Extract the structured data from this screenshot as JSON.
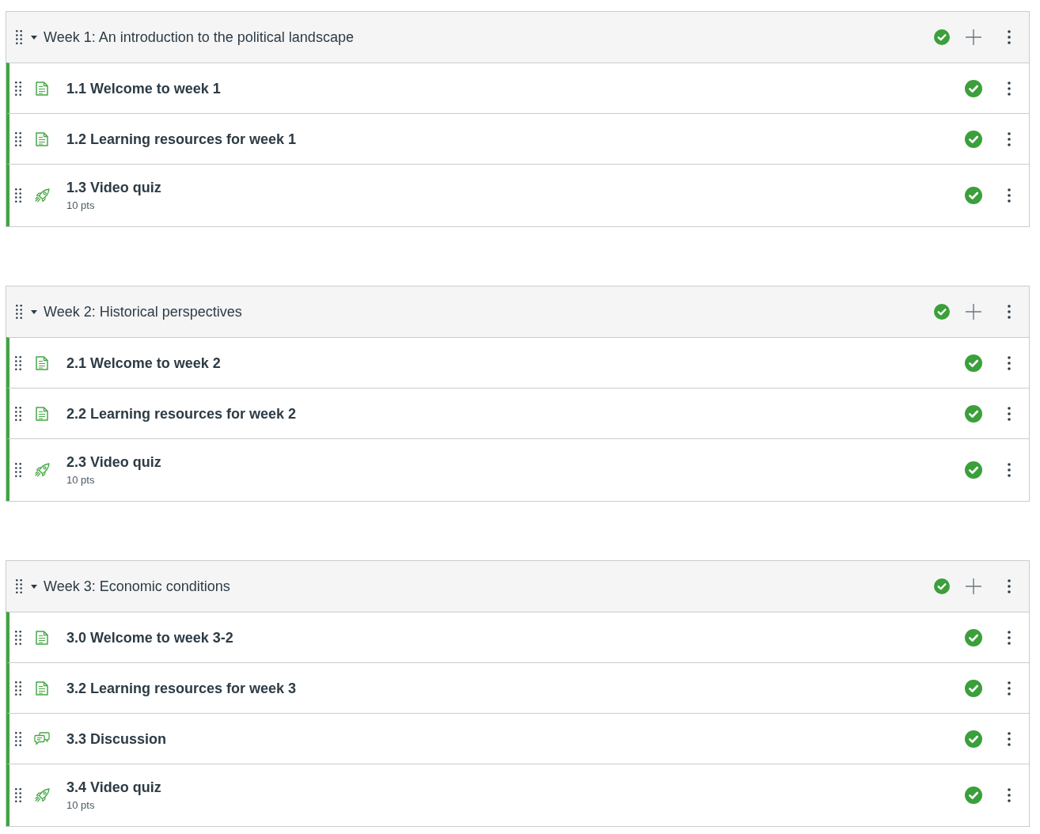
{
  "modules": [
    {
      "title": "Week 1: An introduction to the political landscape",
      "expanded": true,
      "published": true,
      "items": [
        {
          "kind": "page",
          "title": "1.1 Welcome to week 1",
          "published": true
        },
        {
          "kind": "page",
          "title": "1.2 Learning resources for week 1",
          "published": true
        },
        {
          "kind": "quiz",
          "title": "1.3 Video quiz",
          "points": "10 pts",
          "published": true
        }
      ]
    },
    {
      "title": "Week 2: Historical perspectives",
      "expanded": true,
      "published": true,
      "items": [
        {
          "kind": "page",
          "title": "2.1 Welcome to week 2",
          "published": true
        },
        {
          "kind": "page",
          "title": "2.2 Learning resources for week 2",
          "published": true
        },
        {
          "kind": "quiz",
          "title": "2.3 Video quiz",
          "points": "10 pts",
          "published": true
        }
      ]
    },
    {
      "title": "Week 3: Economic conditions",
      "expanded": true,
      "published": true,
      "items": [
        {
          "kind": "page",
          "title": "3.0 Welcome to week 3-2",
          "published": true
        },
        {
          "kind": "page",
          "title": "3.2 Learning resources for week 3",
          "published": true
        },
        {
          "kind": "discussion",
          "title": "3.3 Discussion",
          "published": true
        },
        {
          "kind": "quiz",
          "title": "3.4 Video quiz",
          "points": "10 pts",
          "published": true
        }
      ]
    }
  ]
}
